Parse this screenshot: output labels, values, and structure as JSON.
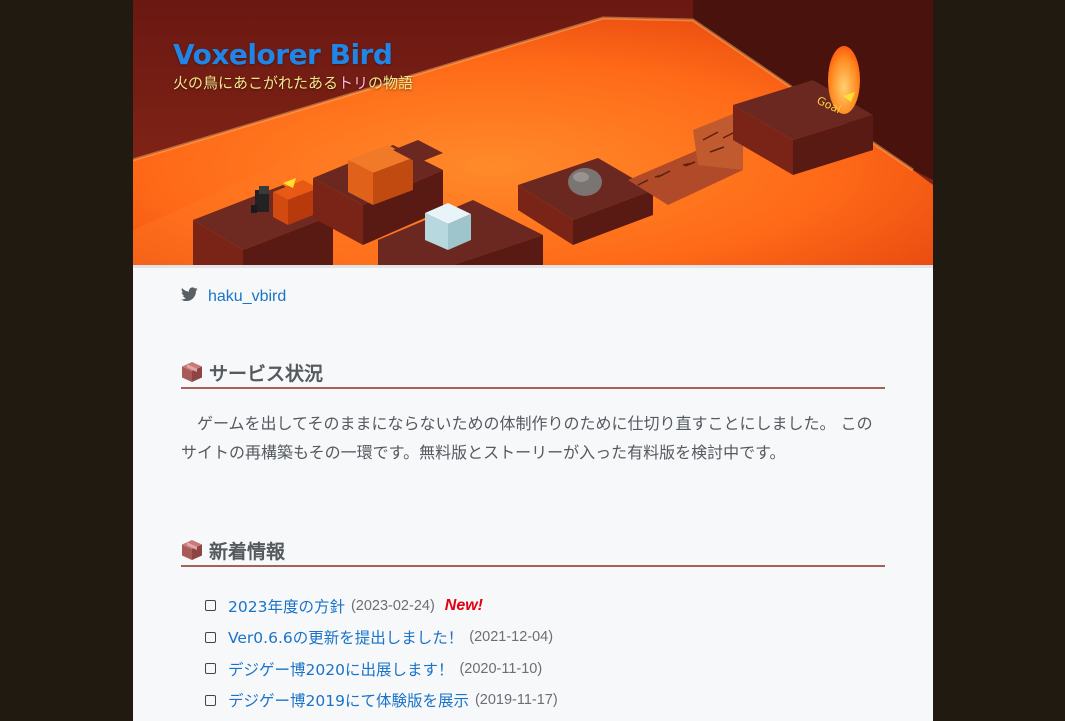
{
  "hero": {
    "title": "Voxelorer Bird",
    "subtitle_a": "火の鳥にあこがれたある",
    "subtitle_highlight": "トリ",
    "subtitle_b": "の物語",
    "goal_label": "Goal"
  },
  "twitter": {
    "handle": "haku_vbird",
    "icon": "twitter-bird-icon"
  },
  "service": {
    "heading": "サービス状況",
    "icon": "cube-icon",
    "text": "ゲームを出してそのままにならないための体制作りのために仕切り直すことにしました。 このサイトの再構築もその一環です。無料版とストーリーが入った有料版を検討中です。"
  },
  "news": {
    "heading": "新着情報",
    "icon": "cube-icon",
    "items": [
      {
        "title": "2023年度の方針",
        "date": "(2023-02-24)",
        "badge": "New!"
      },
      {
        "title": "Ver0.6.6の更新を提出しました！",
        "date": "(2021-12-04)",
        "badge": ""
      },
      {
        "title": "デジゲー博2020に出展します！",
        "date": "(2020-11-10)",
        "badge": ""
      },
      {
        "title": "デジゲー博2019にて体験版を展示",
        "date": "(2019-11-17)",
        "badge": ""
      }
    ]
  },
  "colors": {
    "page_bg": "#211a10",
    "content_bg": "#f7f8fa",
    "link": "#1a73c8",
    "title_blue": "#1f86e8",
    "heading_rule": "#a5605a",
    "new_badge": "#e00010",
    "lava": "#ff6a1a"
  }
}
